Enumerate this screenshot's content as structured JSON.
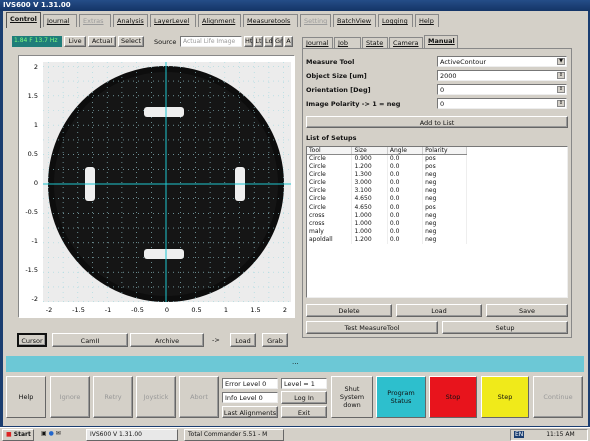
{
  "window": {
    "title": "IVS600 V 1.31.00"
  },
  "tabs": [
    {
      "label": "Control",
      "state": "active"
    },
    {
      "label": "Journal",
      "state": "normal"
    },
    {
      "label": "Extras",
      "state": "disabled"
    },
    {
      "label": "Analysis",
      "state": "normal"
    },
    {
      "label": "LayerLevel",
      "state": "normal"
    },
    {
      "label": "Alignment",
      "state": "normal"
    },
    {
      "label": "Measuretools",
      "state": "normal"
    },
    {
      "label": "Setting",
      "state": "disabled"
    },
    {
      "label": "BatchView",
      "state": "normal"
    },
    {
      "label": "Logging",
      "state": "normal"
    },
    {
      "label": "Help",
      "state": "normal"
    }
  ],
  "image_toolbar": {
    "fps": "1.84 F 13.7 Hz",
    "live": "Live",
    "actual": "Actual",
    "select": "Select",
    "source_label": "Source",
    "source_value": "Actual Life Image",
    "zoom_buttons": [
      "Ht",
      "Lt",
      "Ld",
      "Gr",
      "A"
    ]
  },
  "plot": {
    "x_ticks": [
      "-2",
      "-1.5",
      "-1",
      "-0.5",
      "0",
      "0.5",
      "1",
      "1.5",
      "2"
    ],
    "y_ticks": [
      "2",
      "1.5",
      "1",
      "0.5",
      "0",
      "-0.5",
      "-1",
      "-1.5",
      "-2"
    ]
  },
  "image_buttons": {
    "cursor": "Cursor",
    "camII": "CamII",
    "archive": "Archive",
    "arrow": "->",
    "load": "Load",
    "grab": "Grab"
  },
  "subtabs": [
    {
      "label": "Journal",
      "state": "normal"
    },
    {
      "label": "Job",
      "state": "normal"
    },
    {
      "label": "State",
      "state": "normal"
    },
    {
      "label": "Camera",
      "state": "normal"
    },
    {
      "label": "Manual",
      "state": "active"
    }
  ],
  "form": {
    "measure_tool_label": "Measure Tool",
    "measure_tool_value": "ActiveContour",
    "object_size_label": "Object Size [um]",
    "object_size_value": "2000",
    "orientation_label": "Orientation [Deg]",
    "orientation_value": "0",
    "polarity_label": "Image Polarity  -> 1 = neg",
    "polarity_value": "0",
    "add_to_list": "Add to List",
    "list_label": "List of Setups"
  },
  "setups": {
    "columns": [
      "Tool",
      "Size",
      "Angle",
      "Polarity"
    ],
    "rows": [
      [
        "Circle",
        "0.900",
        "0.0",
        "pos"
      ],
      [
        "Circle",
        "1.200",
        "0.0",
        "pos"
      ],
      [
        "Circle",
        "1.300",
        "0.0",
        "neg"
      ],
      [
        "Circle",
        "3.000",
        "0.0",
        "neg"
      ],
      [
        "Circle",
        "3.100",
        "0.0",
        "neg"
      ],
      [
        "Circle",
        "4.650",
        "0.0",
        "neg"
      ],
      [
        "Circle",
        "4.650",
        "0.0",
        "pos"
      ],
      [
        "cross",
        "1.000",
        "0.0",
        "neg"
      ],
      [
        "cross",
        "1.000",
        "0.0",
        "neg"
      ],
      [
        "maly",
        "1.000",
        "0.0",
        "neg"
      ],
      [
        "apoldall",
        "1.200",
        "0.0",
        "neg"
      ]
    ]
  },
  "list_buttons": {
    "delete": "Delete",
    "load": "Load",
    "save": "Save",
    "test": "Test MeasureTool",
    "setup": "Setup"
  },
  "status_bar": {
    "text": "..."
  },
  "bottom": {
    "help": "Help",
    "ignore": "Ignore",
    "retry": "Retry",
    "joystick": "Joystick",
    "abort": "Abort",
    "error_level": "Error Level 0",
    "info_level": "Info  Level 0",
    "level": "Level = 1",
    "login": "Log In",
    "last_alignments": "Last Alignments",
    "exit": "Exit",
    "shut_system_down": "Shut System down",
    "program_status": "Program Status",
    "stop": "Stop",
    "step": "Step",
    "continue": "Continue"
  },
  "taskbar": {
    "start": "Start",
    "items": [
      "IVS600 V 1.31.00",
      "Total Commander 5.51 - M"
    ],
    "lang": "EN",
    "clock": "11:15 AM"
  },
  "colors": {
    "cyan_bar": "#6cc8d6",
    "program_status": "#2dbfcd",
    "stop": "#e8141c",
    "step": "#f0ea1a"
  }
}
